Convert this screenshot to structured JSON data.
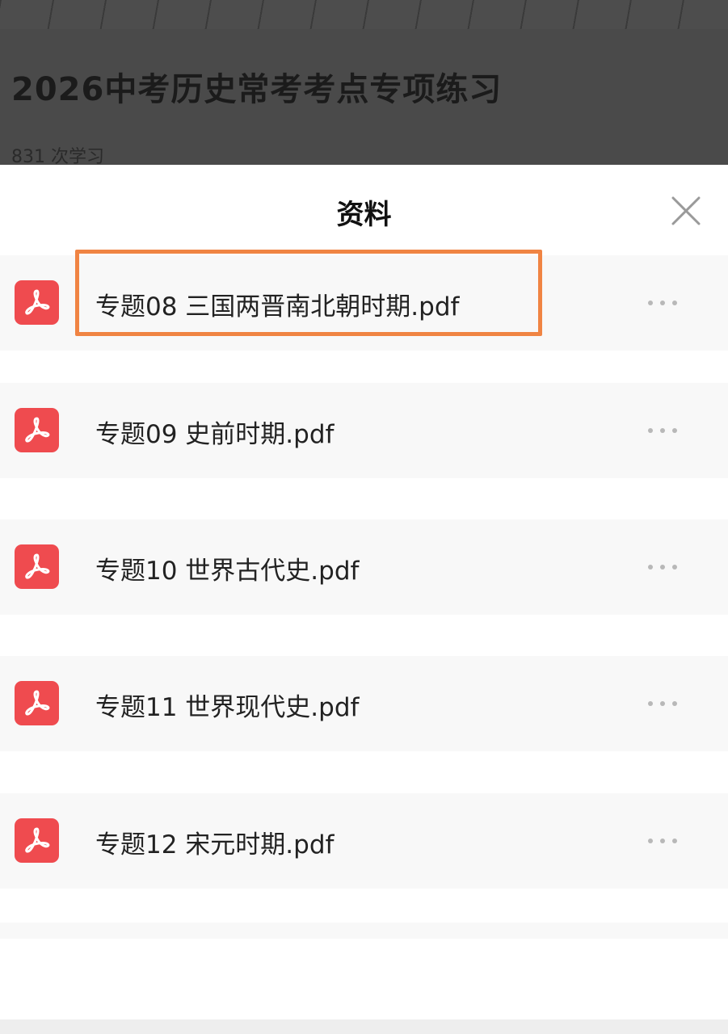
{
  "background_page": {
    "title": "2026中考历史常考考点专项练习",
    "study_count": "831 次学习"
  },
  "sheet": {
    "title": "资料",
    "close_icon": "close-icon",
    "files": [
      {
        "name": "专题08 三国两晋南北朝时期.pdf",
        "icon": "pdf-icon",
        "highlighted": true
      },
      {
        "name": "专题09 史前时期.pdf",
        "icon": "pdf-icon",
        "highlighted": false
      },
      {
        "name": "专题10 世界古代史.pdf",
        "icon": "pdf-icon",
        "highlighted": false
      },
      {
        "name": "专题11 世界现代史.pdf",
        "icon": "pdf-icon",
        "highlighted": false
      },
      {
        "name": "专题12 宋元时期.pdf",
        "icon": "pdf-icon",
        "highlighted": false
      }
    ]
  },
  "colors": {
    "pdf_icon": "#ef4b4f",
    "highlight_border": "#f08443",
    "row_background": "#f8f8f8",
    "overlay_dim": "#4a4a4a"
  }
}
